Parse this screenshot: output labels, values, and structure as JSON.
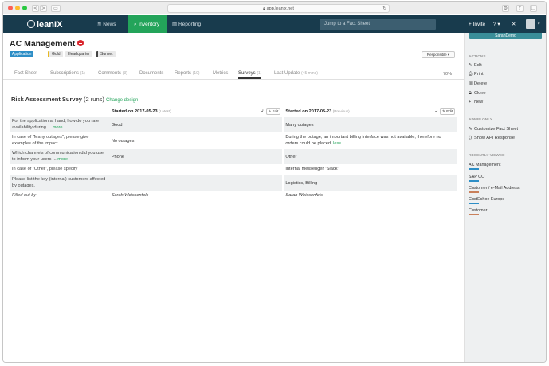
{
  "browser": {
    "url": "app.leanix.net",
    "back": "<",
    "forward": ">"
  },
  "nav": {
    "logo": "leanIX",
    "items": [
      {
        "label": "News",
        "icon": "rss-icon"
      },
      {
        "label": "Inventory",
        "icon": "search-icon",
        "active": true
      },
      {
        "label": "Reporting",
        "icon": "bar-chart-icon"
      }
    ],
    "jump_placeholder": "Jump to a Fact Sheet",
    "invite": "+ Invite",
    "help": "?",
    "tools": "✕"
  },
  "page": {
    "title": "AC Management",
    "tags": [
      {
        "label": "Application",
        "color": "#2d8ec6"
      },
      {
        "label": "Gold",
        "color": "#e9e9e9"
      },
      {
        "label": "Headquarter",
        "color": "#e9e9e9"
      },
      {
        "label": "Sunset",
        "color": "#e9e9e9"
      }
    ],
    "responsible": "Responsible ▾"
  },
  "tabs": [
    {
      "label": "Fact Sheet",
      "count": ""
    },
    {
      "label": "Subscriptions",
      "count": "(1)"
    },
    {
      "label": "Comments",
      "count": "(3)"
    },
    {
      "label": "Documents",
      "count": ""
    },
    {
      "label": "Reports",
      "count": "(10)"
    },
    {
      "label": "Metrics",
      "count": ""
    },
    {
      "label": "Surveys",
      "count": "(1)",
      "active": true
    },
    {
      "label": "Last Update",
      "count": "(45 mins)"
    }
  ],
  "completion": "70%",
  "survey": {
    "title": "Risk Assessment Survey",
    "runs": "(2 runs)",
    "change": "Change design",
    "col1": {
      "label": "Started on 2017-05-23",
      "sub": "(Latest)"
    },
    "col2": {
      "label": "Started on 2017-05-23",
      "sub": "(Previous)"
    },
    "edit": "Edit",
    "rows": [
      {
        "q": "For the application at hand, how do you rate availability during ...",
        "q_more": "more",
        "a1": "Good",
        "a2": "Many outages",
        "a2_more": ""
      },
      {
        "q": "In case of \"Many outages\", please give examples of the impact.",
        "q_more": "",
        "a1": "No outages",
        "a2": "During the outage, an important billing interface was not available, therefore no orders could be placed.",
        "a2_more": "less"
      },
      {
        "q": "Which channels of communication did you use to inform your users ...",
        "q_more": "more",
        "a1": "Phone",
        "a2": "Other",
        "a2_more": ""
      },
      {
        "q": "In case of \"Other\", please specify",
        "q_more": "",
        "a1": "",
        "a2": "Internal messenger \"Slack\"",
        "a2_more": ""
      },
      {
        "q": "Please list the key (internal) customers affected by outages.",
        "q_more": "",
        "a1": "",
        "a2": "Logistics, Billing",
        "a2_more": ""
      }
    ],
    "filled_by": {
      "label": "Filled out by",
      "a1": "Sarah Weissenfels",
      "a2": "Sarah Weissenfels"
    }
  },
  "sidebar": {
    "user_button": "SarahDemo",
    "actions_title": "ACTIONS",
    "actions": [
      {
        "label": "Edit",
        "icon": "pencil-icon"
      },
      {
        "label": "Print",
        "icon": "printer-icon"
      },
      {
        "label": "Delete",
        "icon": "trash-icon"
      },
      {
        "label": "Clone",
        "icon": "clone-icon"
      },
      {
        "label": "New",
        "icon": "plus-icon"
      }
    ],
    "admin_title": "ADMIN ONLY",
    "admin": [
      {
        "label": "Customize Fact Sheet",
        "icon": "wrench-icon"
      },
      {
        "label": "Show API Response",
        "icon": "code-icon"
      }
    ],
    "recent_title": "RECENTLY VIEWED",
    "recent": [
      {
        "label": "AC Management",
        "color": "#2d8ec6"
      },
      {
        "label": "SAP CO",
        "color": "#2d8ec6"
      },
      {
        "label": "Customer / e-Mail Address",
        "color": "#c9805b"
      },
      {
        "label": "CustEchoe Europe",
        "color": "#2d8ec6"
      },
      {
        "label": "Customer",
        "color": "#c9805b"
      }
    ]
  }
}
